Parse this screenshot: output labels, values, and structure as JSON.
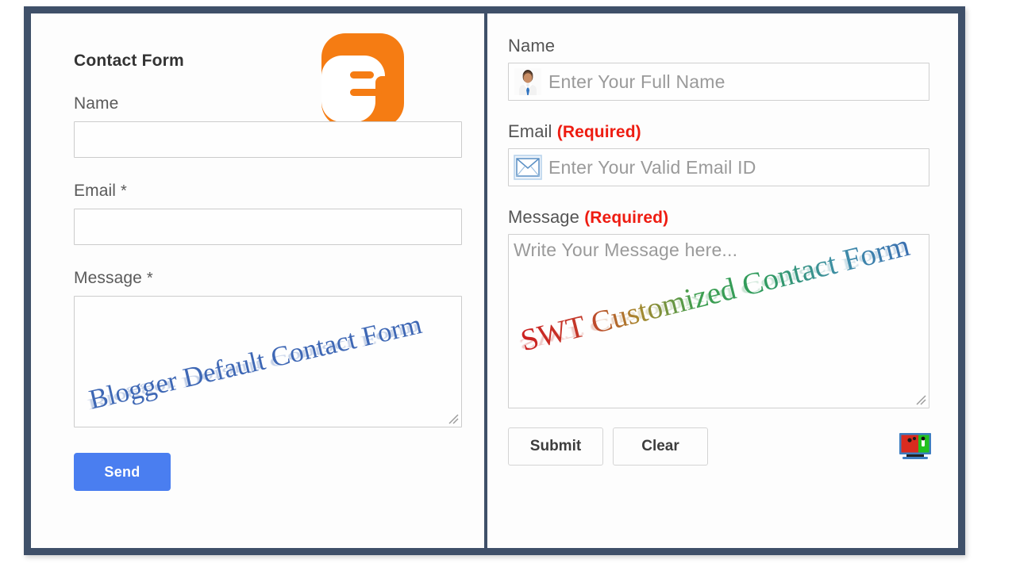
{
  "frame": {
    "border_color": "#3f5069",
    "divider_color": "#3f5069"
  },
  "left_panel": {
    "heading": "Contact Form",
    "logo": {
      "name": "blogger-logo",
      "color": "#f57c13",
      "glyph": "B"
    },
    "fields": [
      {
        "label": "Name",
        "required_mark": "",
        "value": ""
      },
      {
        "label": "Email",
        "required_mark": "*",
        "value": ""
      },
      {
        "label": "Message",
        "required_mark": "*",
        "value": ""
      }
    ],
    "name_label": "Name",
    "email_label": "Email",
    "email_mark": "*",
    "message_label": "Message",
    "message_mark": "*",
    "send_label": "Send",
    "send_color": "#4a7ef0",
    "watermark": "Blogger Default Contact Form",
    "watermark_color": "#3f68b5"
  },
  "right_panel": {
    "name_label": "Name",
    "name_placeholder": "Enter Your Full Name",
    "name_icon": "user-avatar-icon",
    "email_label": "Email",
    "email_required": "(Required)",
    "email_placeholder": "Enter Your Valid Email ID",
    "email_icon": "envelope-icon",
    "message_label": "Message",
    "message_required": "(Required)",
    "message_placeholder": "Write Your Message here...",
    "submit_label": "Submit",
    "clear_label": "Clear",
    "brand_icon": "tv-monitor-icon",
    "required_color": "#ee1c11",
    "watermark": "SWT Customized Contact Form"
  }
}
